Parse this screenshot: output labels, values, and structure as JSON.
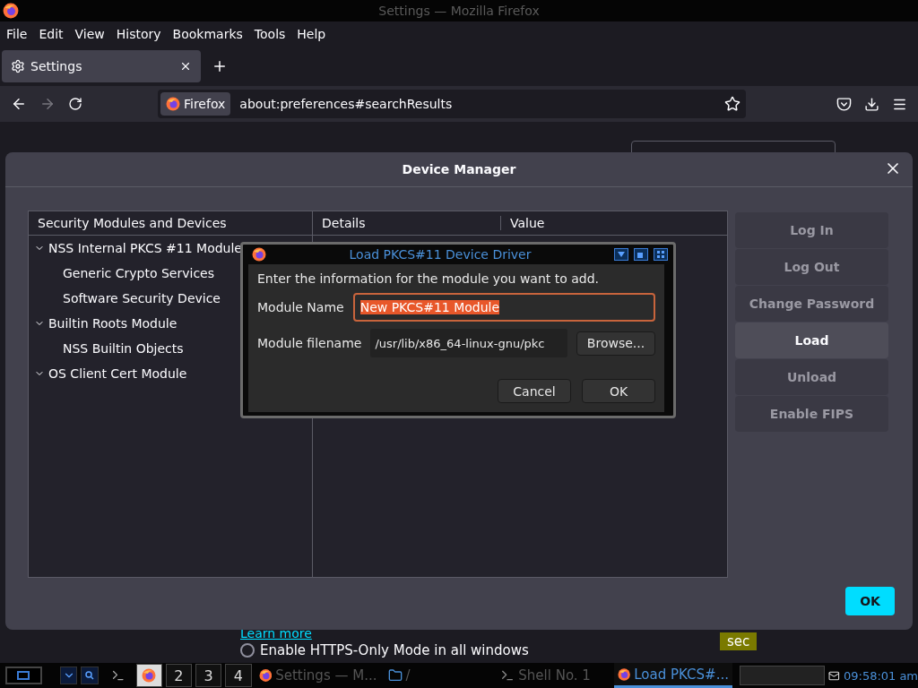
{
  "window": {
    "title": "Settings — Mozilla Firefox"
  },
  "menu_bar": [
    "File",
    "Edit",
    "View",
    "History",
    "Bookmarks",
    "Tools",
    "Help"
  ],
  "tabs": [
    {
      "label": "Settings",
      "selected": true
    }
  ],
  "address_bar": {
    "identity": "Firefox",
    "url": "about:preferences#searchResults"
  },
  "page": {
    "link": "Learn more",
    "radio": {
      "label": "Enable HTTPS-Only Mode in all windows",
      "selected": false
    }
  },
  "device_manager": {
    "title": "Device Manager",
    "tree": {
      "column": "Security Modules and Devices",
      "items": [
        {
          "label": "NSS Internal PKCS #11 Module",
          "expanded": true,
          "children": [
            {
              "label": "Generic Crypto Services"
            },
            {
              "label": "Software Security Device"
            }
          ]
        },
        {
          "label": "Builtin Roots Module",
          "expanded": true,
          "children": [
            {
              "label": "NSS Builtin Objects"
            }
          ]
        },
        {
          "label": "OS Client Cert Module",
          "expanded": true
        }
      ]
    },
    "details_columns": [
      "Details",
      "Value"
    ],
    "buttons": [
      {
        "label": "Log In",
        "disabled": true
      },
      {
        "label": "Log Out",
        "disabled": true
      },
      {
        "label": "Change Password",
        "disabled": true
      },
      {
        "label": "Load",
        "disabled": false
      },
      {
        "label": "Unload",
        "disabled": true
      },
      {
        "label": "Enable FIPS",
        "disabled": true
      }
    ],
    "ok": "OK"
  },
  "load_dialog": {
    "title": "Load PKCS#11 Device Driver",
    "prompt": "Enter the information for the module you want to add.",
    "name_label": "Module Name",
    "name_value": "New PKCS#11 Module",
    "name_selected": true,
    "file_label": "Module filename",
    "file_value": "/usr/lib/x86_64-linux-gnu/pkc",
    "browse": "Browse...",
    "cancel": "Cancel",
    "ok": "OK"
  },
  "taskbar": {
    "workspaces": [
      {
        "selected": true
      },
      {
        "label": "2",
        "selected": false
      },
      {
        "label": "3",
        "selected": false
      },
      {
        "label": "4",
        "selected": false
      }
    ],
    "tasks": [
      {
        "kind": "browser",
        "label": "Settings — M...",
        "selected": false
      },
      {
        "kind": "folder",
        "label": "/",
        "selected": false
      },
      {
        "kind": "terminal",
        "label": "Shell No. 1",
        "selected": false
      },
      {
        "kind": "browser",
        "label": "Load PKCS#...",
        "selected": true
      }
    ],
    "clock": "09:58:01",
    "clock_suffix": "am",
    "tooltip": "sec"
  }
}
